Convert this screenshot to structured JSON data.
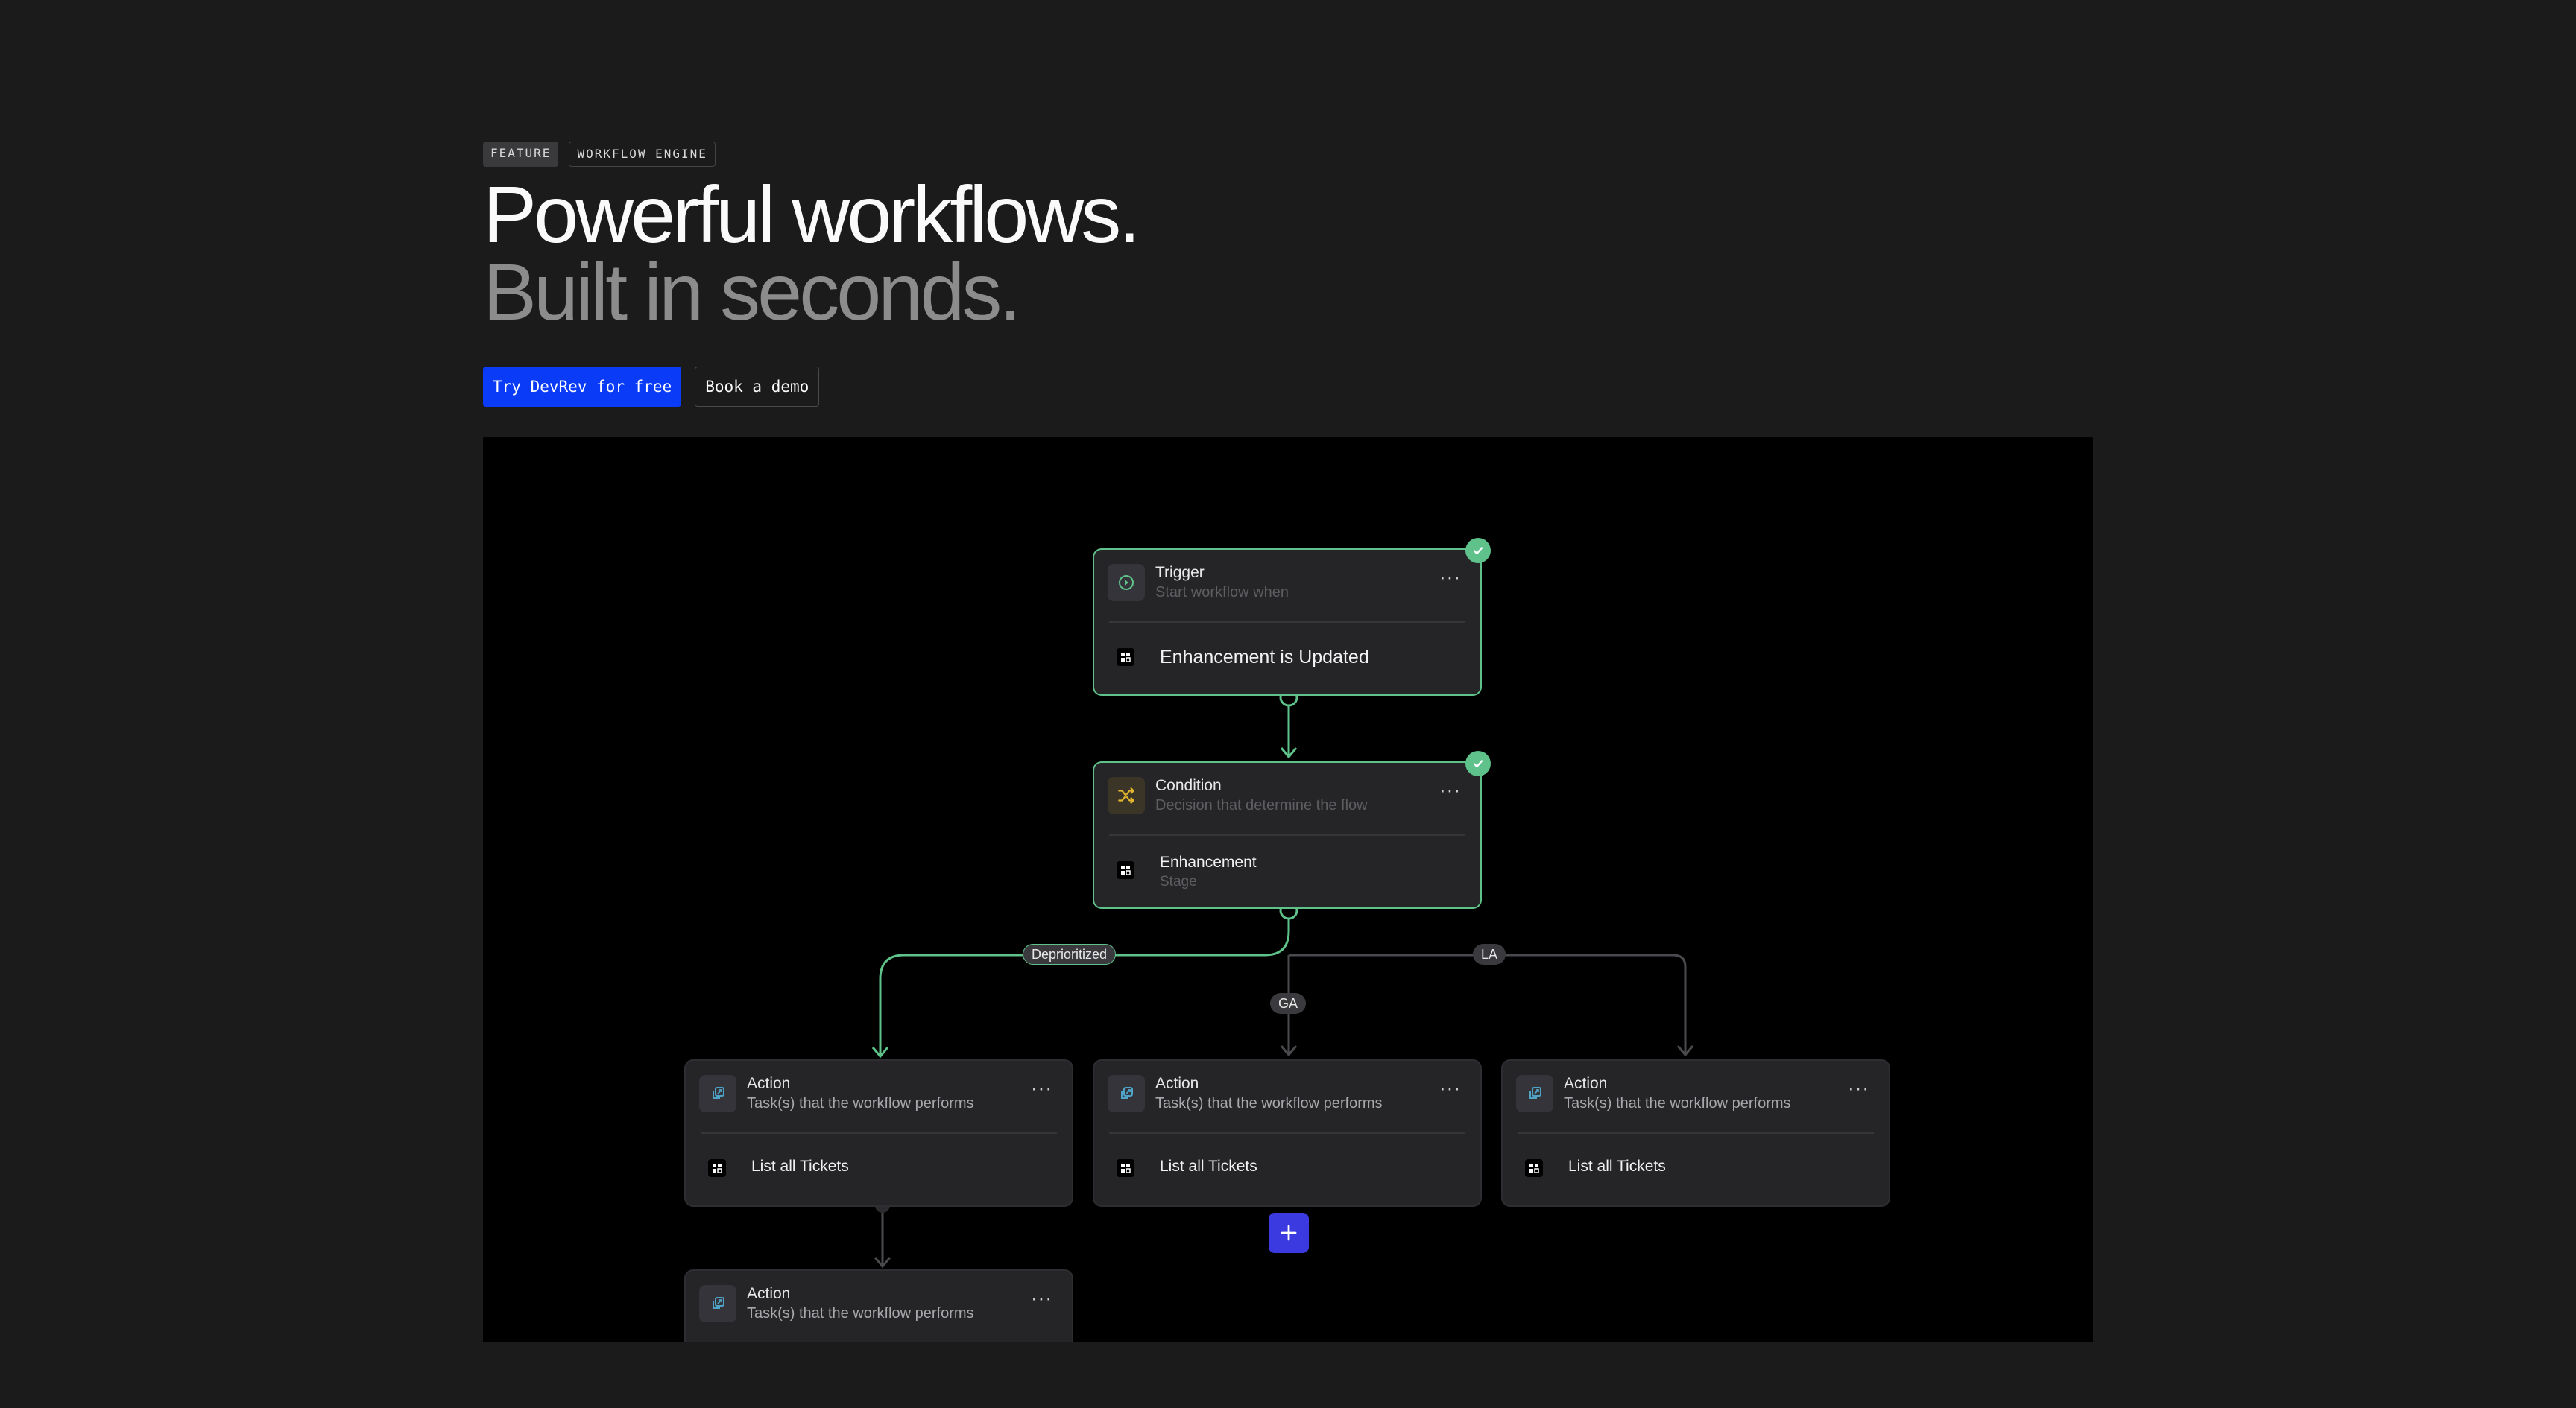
{
  "hero": {
    "tags": [
      "FEATURE",
      "WORKFLOW ENGINE"
    ],
    "title_line1": "Powerful workflows.",
    "title_line2": "Built in seconds.",
    "cta_primary": "Try DevRev for free",
    "cta_secondary": "Book a demo"
  },
  "workflow": {
    "trigger": {
      "title": "Trigger",
      "subtitle": "Start workflow when",
      "body": "Enhancement is Updated"
    },
    "condition": {
      "title": "Condition",
      "subtitle": "Decision that determine the flow",
      "body": "Enhancement",
      "body_sub": "Stage"
    },
    "branches": [
      "Deprioritized",
      "GA",
      "LA"
    ],
    "actions": [
      {
        "title": "Action",
        "subtitle": "Task(s) that the workflow performs",
        "body": "List all Tickets"
      },
      {
        "title": "Action",
        "subtitle": "Task(s) that the workflow performs",
        "body": "List all Tickets"
      },
      {
        "title": "Action",
        "subtitle": "Task(s) that the workflow performs",
        "body": "List all Tickets"
      },
      {
        "title": "Action",
        "subtitle": "Task(s) that the workflow performs"
      }
    ],
    "more_glyph": "···",
    "colors": {
      "active": "#5ec28a",
      "inactive": "#4a4a4e",
      "primary": "#0a3cf7",
      "add": "#3a3ae0"
    }
  }
}
